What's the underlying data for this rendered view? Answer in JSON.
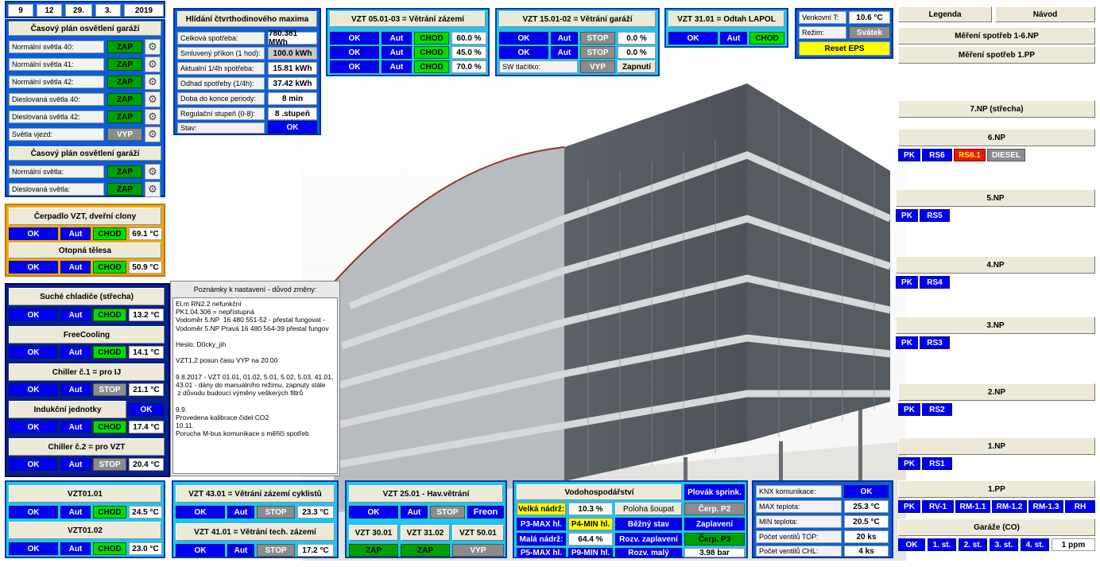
{
  "date": {
    "day": "9",
    "hour": "12",
    "d2": "29.",
    "month": "3.",
    "year": "2019"
  },
  "garage_light": {
    "title": "Časový plán osvětlení garáží",
    "rows": [
      {
        "label": "Normální světla 40:",
        "value": "ZAP"
      },
      {
        "label": "Normální světla 41:",
        "value": "ZAP"
      },
      {
        "label": "Normální světla 42:",
        "value": "ZAP"
      },
      {
        "label": "Dieslovaná světla 40:",
        "value": "ZAP"
      },
      {
        "label": "Dieslovaná světla 42:",
        "value": "ZAP"
      },
      {
        "label": "Světla vjezd:",
        "value": "VYP"
      }
    ],
    "title2": "Časový plán osvětlení garáží",
    "rows2": [
      {
        "label": "Normální světla:",
        "value": "ZAP"
      },
      {
        "label": "Dieslovaná světla:",
        "value": "ZAP"
      }
    ]
  },
  "max_watch": {
    "title": "Hlídání čtvrthodinového maxima",
    "rows": [
      {
        "label": "Celková spotřeba:",
        "value": "780.381 MWh"
      },
      {
        "label": "Smluvený příkon (1 hod):",
        "value": "100.0 kWh"
      },
      {
        "label": "Aktualní 1/4h spotřeba:",
        "value": "15.81 kWh"
      },
      {
        "label": "Odhad spotřeby (1/4h):",
        "value": "37.42 kWh"
      },
      {
        "label": "Doba do konce periody:",
        "value": "8 min"
      },
      {
        "label": "Regulační stupeň (0-8):",
        "value": "8 .stupeň"
      },
      {
        "label": "Stav:",
        "value": "OK"
      }
    ]
  },
  "vzt0501": {
    "title": "VZT 05.01-03 = Větrání zázemí",
    "rows": [
      {
        "ok": "OK",
        "aut": "Aut",
        "state": "CHOD",
        "value": "60.0 %"
      },
      {
        "ok": "OK",
        "aut": "Aut",
        "state": "CHOD",
        "value": "45.0 %"
      },
      {
        "ok": "OK",
        "aut": "Aut",
        "state": "CHOD",
        "value": "70.0 %"
      }
    ]
  },
  "vzt1501": {
    "title": "VZT 15.01-02 = Větrání garáží",
    "rows": [
      {
        "ok": "OK",
        "aut": "Aut",
        "state": "STOP",
        "value": "0.0 %"
      },
      {
        "ok": "OK",
        "aut": "Aut",
        "state": "STOP",
        "value": "0.0 %"
      }
    ],
    "sw_label": "SW tlačítko:",
    "sw_state": "VYP",
    "sw_btn": "Zapnutí"
  },
  "vzt3101": {
    "title": "VZT 31.01 = Odtah LAPOL",
    "ok": "OK",
    "aut": "Aut",
    "state": "CHOD"
  },
  "outdoor": {
    "temp_label": "Venkovní T:",
    "temp_value": "10.6 °C",
    "mode_label": "Režim:",
    "mode_value": "Svátek",
    "reset": "Reset EPS"
  },
  "right_top": {
    "legend": "Legenda",
    "manual": "Návod",
    "meter1": "Měření spotřeb 1-6.NP",
    "meter2": "Měření spotřeb 1.PP"
  },
  "floors": [
    {
      "title": "7.NP (střecha)",
      "buttons": []
    },
    {
      "title": "6.NP",
      "buttons": [
        "PK",
        "RS6",
        "RS6.1",
        "DIESEL"
      ]
    },
    {
      "title": "5.NP",
      "buttons": [
        "PK",
        "RS5"
      ]
    },
    {
      "title": "4.NP",
      "buttons": [
        "PK",
        "RS4"
      ]
    },
    {
      "title": "3.NP",
      "buttons": [
        "PK",
        "RS3"
      ]
    },
    {
      "title": "2.NP",
      "buttons": [
        "PK",
        "RS2"
      ]
    },
    {
      "title": "1.NP",
      "buttons": [
        "PK",
        "RS1"
      ]
    },
    {
      "title": "1.PP",
      "buttons": [
        "PK",
        "RV-1",
        "RM-1.1",
        "RM-1.2",
        "RM-1.3",
        "RH"
      ]
    }
  ],
  "garages_co": {
    "title": "Garáže (CO)",
    "ok": "OK",
    "levels": [
      "1. st.",
      "2. st.",
      "3. st.",
      "4. st."
    ],
    "value": "1 ppm"
  },
  "pump": {
    "title": "Čerpadlo VZT, dveřní clony",
    "ok": "OK",
    "aut": "Aut",
    "state": "CHOD",
    "value": "69.1 °C",
    "title2": "Otopná tělesa",
    "ok2": "OK",
    "aut2": "Aut",
    "state2": "CHOD",
    "value2": "50.9 °C"
  },
  "cooling": [
    {
      "title": "Suché chladiče (střecha)",
      "ok": "OK",
      "aut": "Aut",
      "state": "CHOD",
      "value": "13.2 °C"
    },
    {
      "title": "FreeCooling",
      "ok": "OK",
      "aut": "Aut",
      "state": "CHOD",
      "value": "14.1 °C"
    },
    {
      "title": "Chiller č.1 = pro IJ",
      "ok": "OK",
      "aut": "Aut",
      "state": "STOP",
      "value": "21.1 °C"
    },
    {
      "title": "Indukční jednotky",
      "ok": "OK",
      "aut": "Aut",
      "state": "CHOD",
      "value": "17.4 °C",
      "title_ok": "OK"
    },
    {
      "title": "Chiller č.2 = pro VZT",
      "ok": "OK",
      "aut": "Aut",
      "state": "STOP",
      "value": "20.4 °C"
    }
  ],
  "notes": {
    "title": "Poznámky k nastavení - důvod změny:",
    "text": "El.m RN2.2 nefunkční\nPK1.04.306 = nepřístupná\nVodoměr 5.NP  16 480 551-52 - přestal fungovat -\nVodoměr 5.NP Pravá 16 480 564-39 přestal fungov\n\nHeslo: D0cky_jih\n\nVZT1,2 posun času VYP na 20:00\n\n9.8.2017 - VZT 01.01, 01.02, 5.01, 5.02, 5.03, 41.01,\n43.01 - dány do manuálního režimu, zapnuty stále\n z důvodu budoucí výměny veškerých filtrů\n\n9.9.\nProvedena kalibrace čidel CO2\n10.11.\nPorucha M-bus komunikace s měřiči spotřeb"
  },
  "vzt01": [
    {
      "title": "VZT01.01",
      "ok": "OK",
      "aut": "Aut",
      "state": "CHOD",
      "value": "24.5 °C"
    },
    {
      "title": "VZT01.02",
      "ok": "OK",
      "aut": "Aut",
      "state": "CHOD",
      "value": "23.0 °C"
    }
  ],
  "vzt43": {
    "title": "VZT 43.01 = Větrání zázemí cyklistů",
    "ok": "OK",
    "aut": "Aut",
    "state": "STOP",
    "value": "23.3 °C",
    "title2": "VZT 41.01 = Větrání tech. zázemí",
    "ok2": "OK",
    "aut2": "Aut",
    "state2": "STOP",
    "value2": "17.2 °C"
  },
  "vzt25": {
    "title": "VZT 25.01 - Hav.větrání",
    "ok": "OK",
    "aut": "Aut",
    "state": "STOP",
    "freon": "Freon",
    "units": [
      {
        "name": "VZT 30.01",
        "state": "ZAP"
      },
      {
        "name": "VZT 31.02",
        "state": "ZAP"
      },
      {
        "name": "VZT 50.01",
        "state": "VYP"
      }
    ]
  },
  "water": {
    "title": "Vodohospodářství",
    "float_btn": "Plovák sprink.",
    "big_tank": "Velká nádrž:",
    "big_val": "10.3 %",
    "pos": "Poloha šoupat",
    "pump2": "Čerp. P2",
    "p3max": "P3-MAX hl.",
    "p4min": "P4-MIN hl.",
    "normal": "Běžný stav",
    "flood": "Zaplavení",
    "small_tank": "Malá nádrž:",
    "small_val": "64.4 %",
    "rozv_flood": "Rozv. zaplavení",
    "pump3": "Čerp. P3",
    "p5max": "P5-MAX hl.",
    "p9min": "P9-MIN hl.",
    "rozv_small": "Rozv. malý",
    "pressure": "3.98 bar"
  },
  "knx": {
    "rows": [
      {
        "label": "KNX komunikace:",
        "value": "OK"
      },
      {
        "label": "MAX teplota:",
        "value": "25.3 °C"
      },
      {
        "label": "MIN teplota:",
        "value": "20.5 °C"
      },
      {
        "label": "Počet ventilů TOP:",
        "value": "20 ks"
      },
      {
        "label": "Počet ventilů CHL:",
        "value": "4 ks"
      }
    ]
  }
}
